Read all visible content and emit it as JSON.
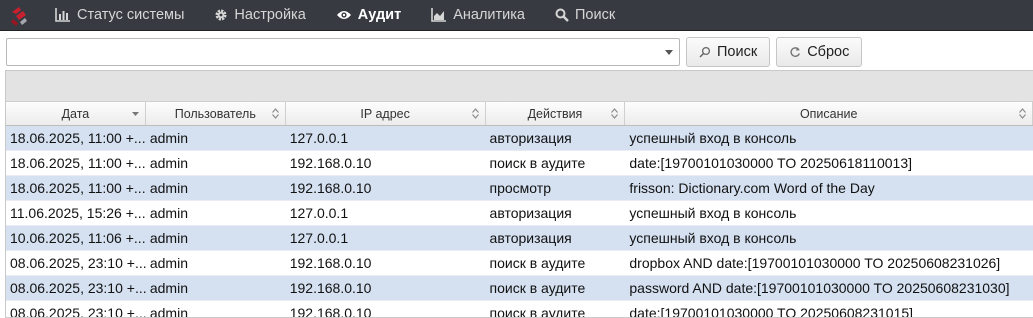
{
  "nav": {
    "items": [
      {
        "label": "Статус системы",
        "icon": "bar-chart-icon",
        "active": false
      },
      {
        "label": "Настройка",
        "icon": "gear-icon",
        "active": false
      },
      {
        "label": "Аудит",
        "icon": "eye-icon",
        "active": true
      },
      {
        "label": "Аналитика",
        "icon": "area-chart-icon",
        "active": false
      },
      {
        "label": "Поиск",
        "icon": "search-icon",
        "active": false
      }
    ]
  },
  "search": {
    "value": "",
    "search_label": "Поиск",
    "reset_label": "Сброс"
  },
  "table": {
    "columns": [
      "Дата",
      "Пользователь",
      "IP адрес",
      "Действия",
      "Описание"
    ],
    "rows": [
      [
        "18.06.2025, 11:00 +...",
        "admin",
        "127.0.0.1",
        "авторизация",
        "успешный вход в консоль"
      ],
      [
        "18.06.2025, 11:00 +...",
        "admin",
        "192.168.0.10",
        "поиск в аудите",
        "date:[19700101030000 TO 20250618110013]"
      ],
      [
        "18.06.2025, 11:00 +...",
        "admin",
        "192.168.0.10",
        "просмотр",
        "frisson: Dictionary.com Word of the Day"
      ],
      [
        "11.06.2025, 15:26 +...",
        "admin",
        "127.0.0.1",
        "авторизация",
        "успешный вход в консоль"
      ],
      [
        "10.06.2025, 11:06 +...",
        "admin",
        "127.0.0.1",
        "авторизация",
        "успешный вход в консоль"
      ],
      [
        "08.06.2025, 23:10 +...",
        "admin",
        "192.168.0.10",
        "поиск в аудите",
        "dropbox AND date:[19700101030000 TO 20250608231026]"
      ],
      [
        "08.06.2025, 23:10 +...",
        "admin",
        "192.168.0.10",
        "поиск в аудите",
        "password AND date:[19700101030000 TO 20250608231030]"
      ],
      [
        "08.06.2025, 23:10 +...",
        "admin",
        "192.168.0.10",
        "поиск в аудите",
        "date:[19700101030000 TO 20250608231015]"
      ]
    ]
  },
  "colors": {
    "navbar": "#373b41",
    "row_highlight": "#d5e1f1",
    "logo_red": "#c8202f"
  }
}
